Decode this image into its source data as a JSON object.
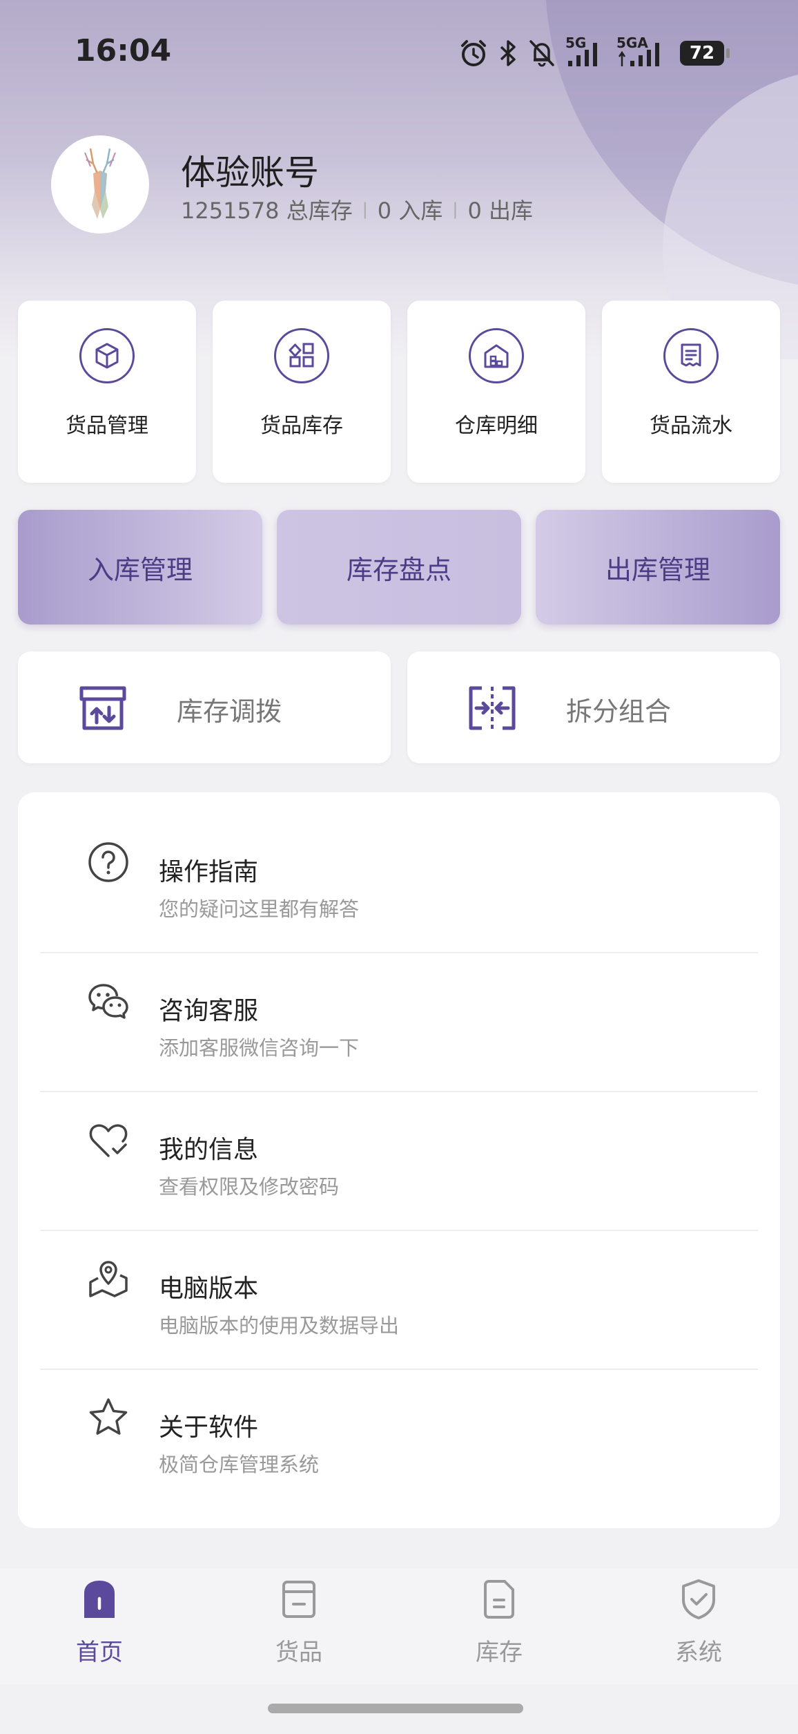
{
  "status_bar": {
    "time": "16:04",
    "icons": [
      "alarm-icon",
      "bluetooth-icon",
      "mute-icon",
      "signal-5g-icon",
      "signal-5ga-icon"
    ],
    "net1": "5G",
    "net2": "5GA",
    "battery": "72"
  },
  "account": {
    "name": "体验账号",
    "total_stock": "1251578 总库存",
    "inbound": "0 入库",
    "outbound": "0 出库"
  },
  "quick_cards": [
    {
      "label": "货品管理",
      "icon": "box-icon"
    },
    {
      "label": "货品库存",
      "icon": "grid-blocks-icon"
    },
    {
      "label": "仓库明细",
      "icon": "warehouse-icon"
    },
    {
      "label": "货品流水",
      "icon": "receipt-icon"
    }
  ],
  "actions": [
    {
      "label": "入库管理"
    },
    {
      "label": "库存盘点"
    },
    {
      "label": "出库管理"
    }
  ],
  "tools": [
    {
      "label": "库存调拨",
      "icon": "transfer-box-icon"
    },
    {
      "label": "拆分组合",
      "icon": "merge-split-icon"
    }
  ],
  "menu": [
    {
      "title": "操作指南",
      "subtitle": "您的疑问这里都有解答",
      "icon": "question-icon"
    },
    {
      "title": "咨询客服",
      "subtitle": "添加客服微信咨询一下",
      "icon": "wechat-icon"
    },
    {
      "title": "我的信息",
      "subtitle": "查看权限及修改密码",
      "icon": "heart-check-icon"
    },
    {
      "title": "电脑版本",
      "subtitle": "电脑版本的使用及数据导出",
      "icon": "map-pin-icon"
    },
    {
      "title": "关于软件",
      "subtitle": "极简仓库管理系统",
      "icon": "star-icon"
    }
  ],
  "tabs": [
    {
      "label": "首页",
      "active": true,
      "icon": "home-icon"
    },
    {
      "label": "货品",
      "active": false,
      "icon": "goods-icon"
    },
    {
      "label": "库存",
      "active": false,
      "icon": "inventory-icon"
    },
    {
      "label": "系统",
      "active": false,
      "icon": "shield-icon"
    }
  ],
  "colors": {
    "accent": "#5b4a9b",
    "action_text": "#4a3d85",
    "header_bg": "#b3abc9",
    "inactive_tab": "#999999"
  }
}
